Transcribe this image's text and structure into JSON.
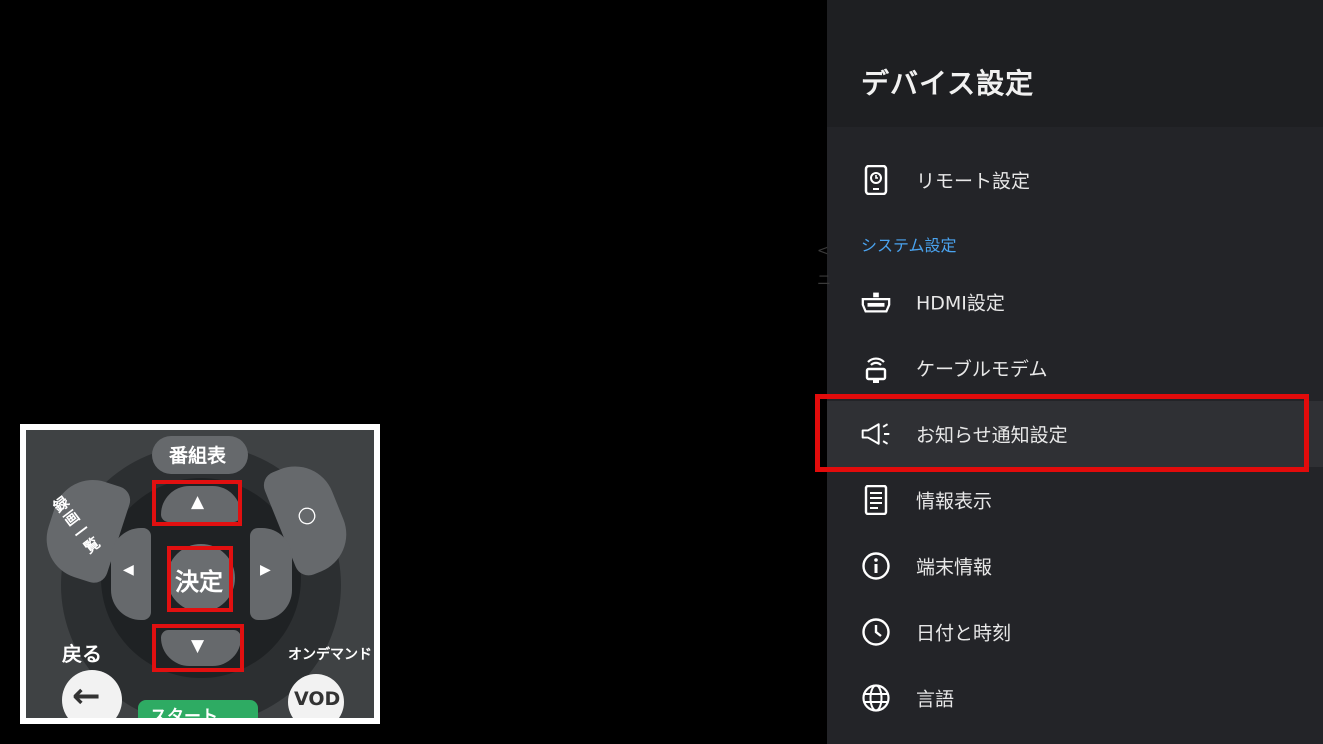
{
  "panel": {
    "title": "デバイス設定",
    "items": [
      {
        "label": "リモート設定",
        "icon": "remote-settings-icon"
      },
      {
        "section": "システム設定"
      },
      {
        "label": "HDMI設定",
        "icon": "hdmi-icon"
      },
      {
        "label": "ケーブルモデム",
        "icon": "cable-modem-icon"
      },
      {
        "label": "お知らせ通知設定",
        "icon": "megaphone-icon",
        "focused": true
      },
      {
        "label": "情報表示",
        "icon": "info-list-icon"
      },
      {
        "label": "端末情報",
        "icon": "info-circle-icon"
      },
      {
        "label": "日付と時刻",
        "icon": "clock-icon"
      },
      {
        "label": "言語",
        "icon": "globe-icon"
      }
    ]
  },
  "remote": {
    "guide_label": "番組表",
    "recording_list_label": "録画一覧",
    "ok_label": "決定",
    "back_label": "戻る",
    "ondemand_label": "オンデマンド",
    "vod_label": "VOD",
    "start_label": "スタート",
    "up_symbol": "▲",
    "down_symbol": "▼",
    "left_symbol": "◀",
    "right_symbol": "▶",
    "circle_symbol": "○",
    "back_symbol": "←"
  },
  "colors": {
    "accent": "#4aa3ef",
    "highlight": "#e20b0b",
    "panel_bg": "#232428"
  }
}
